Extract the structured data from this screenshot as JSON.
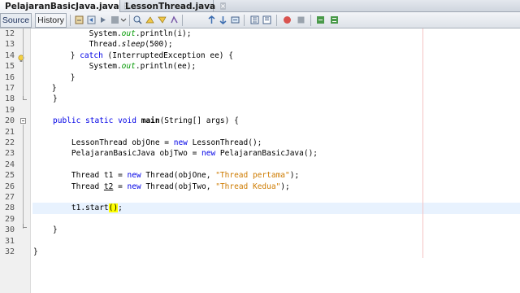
{
  "tabs": [
    {
      "label": "PelajaranBasicJava.java",
      "active": true
    },
    {
      "label": "LessonThread.java",
      "active": false
    }
  ],
  "toolbar": {
    "source_label": "Source",
    "history_label": "History",
    "icons": [
      "last-edit-icon",
      "back-icon",
      "forward-icon",
      "find-icon",
      "find-previous-icon",
      "find-next-icon",
      "toggle-highlight-icon",
      "previous-bookmark-icon",
      "next-bookmark-icon",
      "toggle-bookmark-icon",
      "shift-left-icon",
      "shift-right-icon",
      "start-macro-icon",
      "stop-macro-icon",
      "comment-icon",
      "uncomment-icon"
    ]
  },
  "editor": {
    "current_line": 28,
    "lines": [
      {
        "n": "12",
        "text": "            System.out.println(i);"
      },
      {
        "n": "13",
        "text": "            Thread.sleep(500);"
      },
      {
        "n": "14",
        "text": "        } catch (InterruptedException ee) {"
      },
      {
        "n": "15",
        "text": "            System.out.println(ee);"
      },
      {
        "n": "16",
        "text": "        }"
      },
      {
        "n": "17",
        "text": "    }"
      },
      {
        "n": "18",
        "text": "}"
      },
      {
        "n": "19",
        "text": ""
      },
      {
        "n": "20",
        "text": "public static void main(String[] args) {"
      },
      {
        "n": "21",
        "text": ""
      },
      {
        "n": "22",
        "text": "    LessonThread objOne = new LessonThread();"
      },
      {
        "n": "23",
        "text": "    PelajaranBasicJava objTwo = new PelajaranBasicJava();"
      },
      {
        "n": "24",
        "text": ""
      },
      {
        "n": "25",
        "text": "    Thread t1 = new Thread(objOne, \"Thread pertama\");"
      },
      {
        "n": "26",
        "text": "    Thread t2 = new Thread(objTwo, \"Thread Kedua\");"
      },
      {
        "n": "27",
        "text": ""
      },
      {
        "n": "28",
        "text": "    t1.start();"
      },
      {
        "n": "29",
        "text": ""
      },
      {
        "n": "30",
        "text": "}"
      },
      {
        "n": "31",
        "text": ""
      },
      {
        "n": "32",
        "text": "}"
      }
    ]
  },
  "colors": {
    "keyword": "#0000e6",
    "string": "#ce7b00",
    "static_field": "#009900",
    "current_line": "#e8f2fe",
    "bracket_match": "#ffff00",
    "right_margin": "#f4c3c3"
  }
}
